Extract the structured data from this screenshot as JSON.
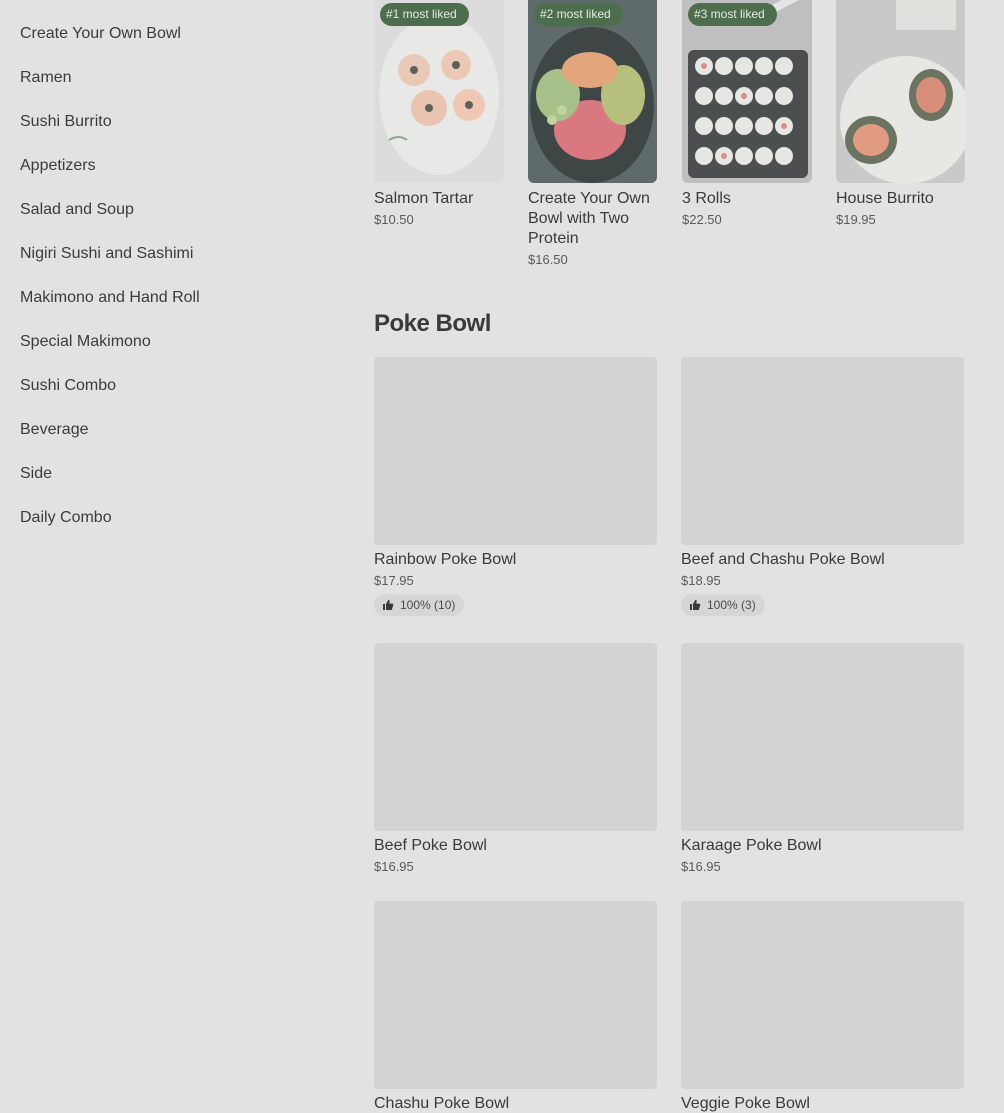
{
  "sidebar": {
    "items": [
      {
        "label": "Create Your Own Bowl"
      },
      {
        "label": "Ramen"
      },
      {
        "label": "Sushi Burrito"
      },
      {
        "label": "Appetizers"
      },
      {
        "label": "Salad and Soup"
      },
      {
        "label": "Nigiri Sushi and Sashimi"
      },
      {
        "label": "Makimono and Hand Roll"
      },
      {
        "label": "Special Makimono"
      },
      {
        "label": "Sushi Combo"
      },
      {
        "label": "Beverage"
      },
      {
        "label": "Side"
      },
      {
        "label": "Daily Combo"
      }
    ]
  },
  "popular": [
    {
      "badge": "#1 most liked",
      "name": " Salmon Tartar",
      "price": "$10.50"
    },
    {
      "badge": "#2 most liked",
      "name": "Create Your Own Bowl with Two Protein",
      "price": "$16.50"
    },
    {
      "badge": "#3 most liked",
      "name": "3 Rolls",
      "price": "$22.50"
    },
    {
      "badge": "",
      "name": " House Burrito",
      "price": "$19.95"
    }
  ],
  "section": {
    "title": "Poke Bowl"
  },
  "items": [
    {
      "name": "Rainbow Poke Bowl",
      "price": "$17.95",
      "rating": "100% (10)"
    },
    {
      "name": "Beef and Chashu Poke Bowl",
      "price": "$18.95",
      "rating": "100% (3)"
    },
    {
      "name": " Beef Poke Bowl",
      "price": "$16.95"
    },
    {
      "name": "Karaage Poke Bowl",
      "price": "$16.95"
    },
    {
      "name": "Chashu Poke Bowl"
    },
    {
      "name": "Veggie Poke Bowl"
    }
  ],
  "icons": {
    "rating": "thumbs-up-icon"
  },
  "colors": {
    "badge_bg": "#4d6e4d",
    "overlay_bg": "#e2e2e2"
  }
}
